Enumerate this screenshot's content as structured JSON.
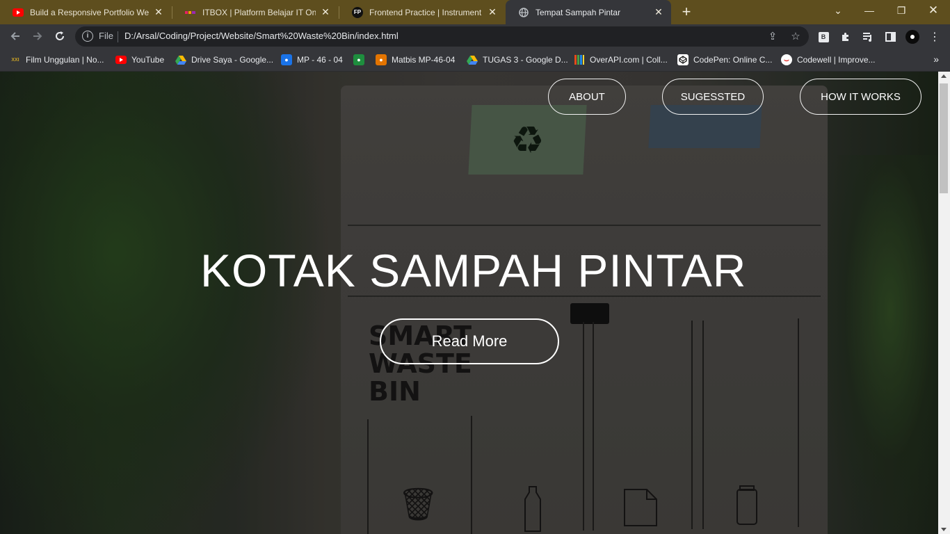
{
  "browser": {
    "tabs": [
      {
        "title": "Build a Responsive Portfolio Web",
        "icon": "youtube-icon",
        "active": false
      },
      {
        "title": "ITBOX | Platform Belajar IT Online",
        "icon": "itbox-icon",
        "active": false
      },
      {
        "title": "Frontend Practice | Instrument Pr",
        "icon": "fp-icon",
        "favicon_text": "FP",
        "active": false
      },
      {
        "title": "Tempat Sampah Pintar",
        "icon": "globe-icon",
        "active": true
      }
    ],
    "address": {
      "scheme_label": "File",
      "url": "D:/Arsal/Coding/Project/Website/Smart%20Waste%20Bin/index.html"
    },
    "extension_badge": "B",
    "bookmarks": [
      {
        "label": "Film Unggulan | No...",
        "icon": "xxi-icon",
        "icon_text": "XXI",
        "color": "#c9a227"
      },
      {
        "label": "YouTube",
        "icon": "youtube-icon",
        "color": "#ff0000"
      },
      {
        "label": "Drive Saya - Google...",
        "icon": "google-drive-icon",
        "color": "#34a853"
      },
      {
        "label": "MP - 46 - 04",
        "icon": "classroom-icon",
        "color": "#1a73e8"
      },
      {
        "label": "",
        "icon": "classroom-green-icon",
        "color": "#1e8e3e"
      },
      {
        "label": "Matbis MP-46-04",
        "icon": "classroom-orange-icon",
        "color": "#e37400"
      },
      {
        "label": "TUGAS 3 - Google D...",
        "icon": "google-drive-icon",
        "color": "#34a853"
      },
      {
        "label": "OverAPI.com | Coll...",
        "icon": "overapi-icon",
        "color": "#e64a19"
      },
      {
        "label": "CodePen: Online C...",
        "icon": "codepen-icon",
        "color": "#ffffff"
      },
      {
        "label": "Codewell | Improve...",
        "icon": "codewell-icon",
        "color": "#e53935"
      }
    ]
  },
  "site": {
    "nav": [
      "ABOUT",
      "SUGESSTED",
      "HOW IT WORKS"
    ],
    "hero_title": "KOTAK SAMPAH PINTAR",
    "cta": "Read More"
  },
  "scene_text": {
    "bin_print": [
      "SMART",
      "WASTE",
      "BIN"
    ]
  }
}
